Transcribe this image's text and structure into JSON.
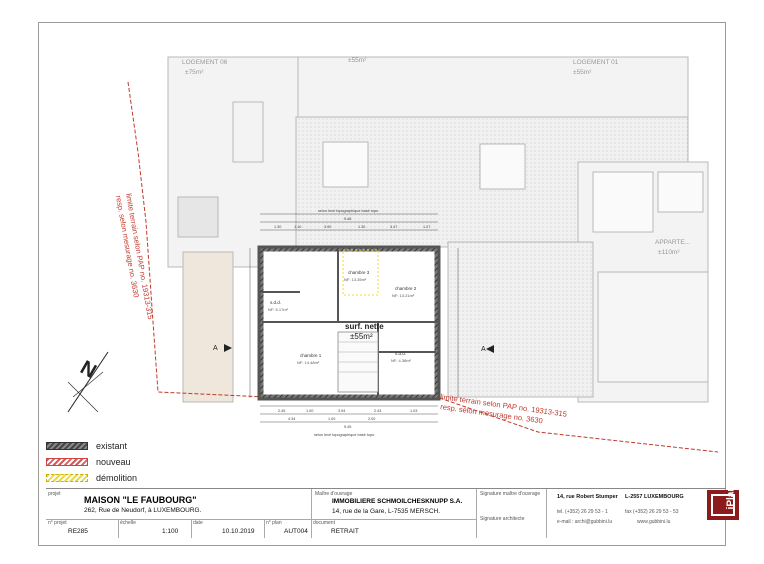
{
  "plan": {
    "logements": [
      "LOGEMENT 06",
      "LOGEMENT 01"
    ],
    "logement_areas": [
      "±75m²",
      "±55m²"
    ],
    "top_area": "±55m²",
    "appartement": "APPARTE...",
    "appartement_area": "±110m²",
    "rooms": [
      {
        "name": "chambre 3",
        "area": "NF: 13.35m²"
      },
      {
        "name": "chambre 2",
        "area": "NF: 13.21m²"
      },
      {
        "name": "s.d.d.",
        "area": "NF: 5.17m²"
      },
      {
        "name": "chambre 1",
        "area": "NF: 14.48m²"
      },
      {
        "name": "s.d.d.",
        "area": "NF: 4.36m²"
      }
    ],
    "surface_label": "surf. nette",
    "surface_value": "±55m²",
    "limit_left_1": "limite terrain selon PAP no. 19313-315",
    "limit_left_2": "resp. selon mesurage no. 3630",
    "limit_right_1": "limite terrain selon PAP no. 19313-315",
    "limit_right_2": "resp. selon mesurage no. 3630",
    "section_marker": "A",
    "dim_top": "selon levé topographique basé topo",
    "dim_bottom": "selon levé topographique basé topo",
    "dims_top_values": [
      "9.48",
      "1.30",
      "1.10",
      "3.90",
      "1.30",
      "3.47",
      "1.27"
    ],
    "dims_bottom_values": [
      "2.45",
      "1.00",
      "3.94",
      "2.43",
      "1.03",
      "4.34",
      "1.00",
      "2.00",
      "9.45"
    ]
  },
  "legend": [
    {
      "label": "existant",
      "style": "exist"
    },
    {
      "label": "nouveau",
      "style": "new"
    },
    {
      "label": "démolition",
      "style": "demo"
    }
  ],
  "title_block": {
    "projet_cap": "projet",
    "projet_name": "MAISON \"LE FAUBOURG\"",
    "projet_addr": "262, Rue de Neudorf, à LUXEMBOURG.",
    "maitre_cap": "Maître d'ouvrage",
    "maitre_name": "IMMOBILIERE SCHMOILCHESKNUPP S.A.",
    "maitre_addr": "14, rue de la Gare, L-7535 MERSCH.",
    "sig_mo": "Signature maître d'ouvrage",
    "sig_arch": "Signature architecte",
    "arch_addr": "14, rue Robert Stumper",
    "arch_city": "L-2557 LUXEMBOURG",
    "tel": "tel. (+352) 26 29 53 - 1",
    "fax": "fax (+352) 26 29 53 - 53",
    "email": "e-mail : archi@gubbini.lu",
    "web": "www.gubbini.lu",
    "n_projet_cap": "n° projet",
    "n_projet": "RE285",
    "echelle_cap": "échelle",
    "echelle": "1:100",
    "date_cap": "date",
    "date": "10.10.2019",
    "n_plan_cap": "n° plan",
    "n_plan": "AUT004",
    "document_cap": "document",
    "document": "RETRAIT",
    "logo_text": "iPlan"
  },
  "colors": {
    "accent": "#8c1c1c",
    "limit": "#c0392b",
    "wall": "#555555"
  }
}
